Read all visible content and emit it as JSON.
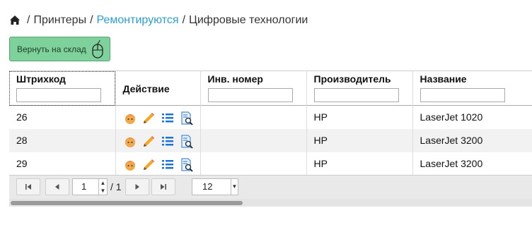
{
  "breadcrumb": {
    "items": [
      "Принтеры",
      "Ремонтируются",
      "Цифровые технологии"
    ],
    "separator": "/",
    "link_color": "#2a9fd6"
  },
  "toolbar": {
    "return_label": "Вернуть на склад",
    "return_color": "#7fd19b"
  },
  "table": {
    "columns": [
      "Штрихкод",
      "Действие",
      "Инв. номер",
      "Производитель",
      "Название"
    ],
    "rows": [
      {
        "barcode": "26",
        "inv": "",
        "maker": "HP",
        "name": "LaserJet 1020"
      },
      {
        "barcode": "28",
        "inv": "",
        "maker": "HP",
        "name": "LaserJet 3200"
      },
      {
        "barcode": "29",
        "inv": "",
        "maker": "HP",
        "name": "LaserJet 3200"
      }
    ],
    "action_icons": [
      "user-icon",
      "pencil-icon",
      "list-icon",
      "document-search-icon"
    ]
  },
  "pager": {
    "page": "1",
    "total": "/ 1",
    "page_size": "12",
    "icons": [
      "first-page-icon",
      "prev-page-icon",
      "next-page-icon",
      "last-page-icon"
    ]
  }
}
